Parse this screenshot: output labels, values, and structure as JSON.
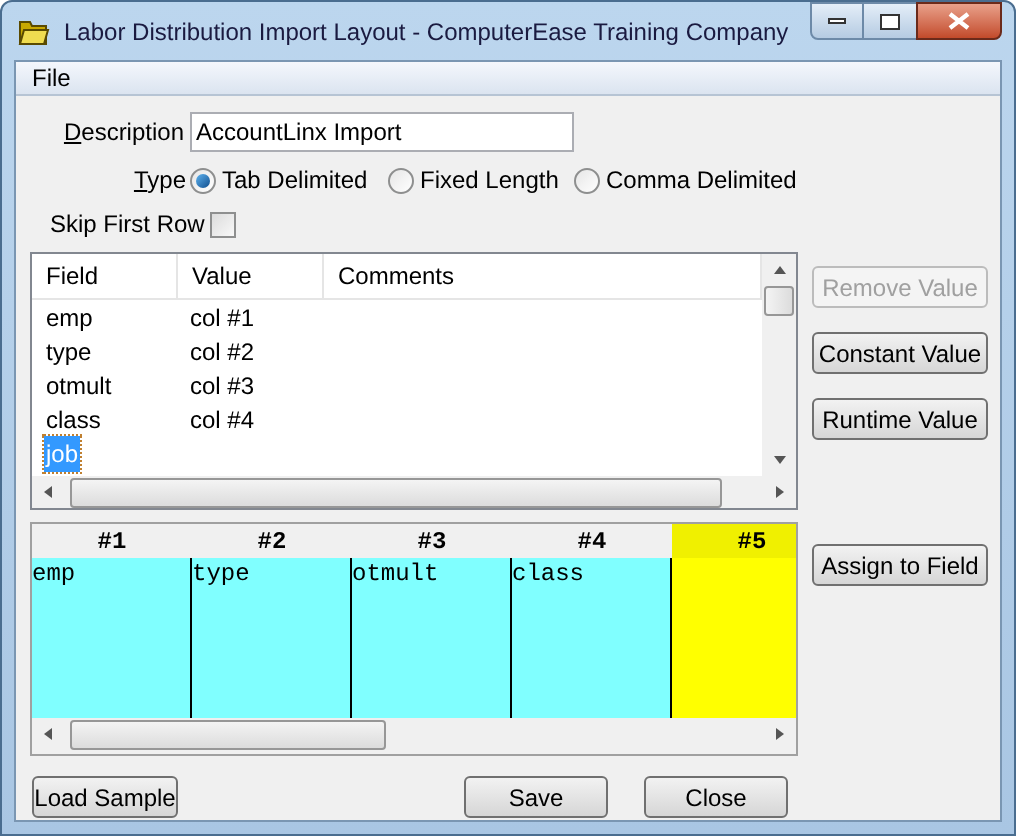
{
  "window": {
    "title": "Labor Distribution Import Layout - ComputerEase Training Company"
  },
  "menu": [
    "File"
  ],
  "description": {
    "label": "Description",
    "value": "AccountLinx Import"
  },
  "type": {
    "label": "Type",
    "options": [
      {
        "label": "Tab Delimited",
        "selected": true
      },
      {
        "label": "Fixed Length",
        "selected": false
      },
      {
        "label": "Comma Delimited",
        "selected": false
      }
    ]
  },
  "skip_first_row": {
    "label": "Skip First Row",
    "checked": false
  },
  "fields_table": {
    "columns": [
      "Field",
      "Value",
      "Comments"
    ],
    "rows": [
      {
        "field": "emp",
        "value": "col #1",
        "selected": false
      },
      {
        "field": "type",
        "value": "col #2",
        "selected": false
      },
      {
        "field": "otmult",
        "value": "col #3",
        "selected": false
      },
      {
        "field": "class",
        "value": "col #4",
        "selected": false
      },
      {
        "field": "job",
        "selected": true
      }
    ]
  },
  "side_buttons": [
    {
      "label": "Remove Value",
      "disabled": true
    },
    {
      "label": "Constant Value",
      "disabled": false
    },
    {
      "label": "Runtime Value",
      "disabled": false
    }
  ],
  "sample_grid": {
    "columns": [
      {
        "label": "#1",
        "cell": "emp",
        "selected": false
      },
      {
        "label": "#2",
        "cell": "type",
        "selected": false
      },
      {
        "label": "#3",
        "cell": "otmult",
        "selected": false
      },
      {
        "label": "#4",
        "cell": "class",
        "selected": false
      },
      {
        "label": "#5",
        "selected": true
      }
    ]
  },
  "assign_button": "Assign to Field",
  "bottom_buttons": [
    "Load Sample",
    "Save",
    "Close"
  ]
}
